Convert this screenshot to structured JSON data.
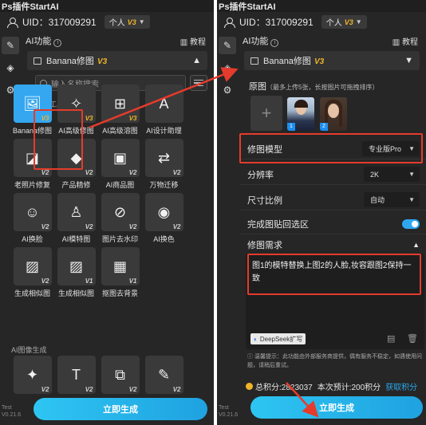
{
  "app": {
    "title": "Ps插件StartAI",
    "version": "Test V0.21.6"
  },
  "account": {
    "uid": "UID：317009291",
    "persona": "个人",
    "persona_badge": "V3"
  },
  "sidebar": {
    "items": [
      {
        "icon": "pen-icon"
      },
      {
        "icon": "layers-icon"
      },
      {
        "icon": "gear-icon"
      }
    ]
  },
  "left": {
    "section_title": "AI功能",
    "tutorial": "教程",
    "selected_model": "Banana修图",
    "selected_badge": "V3",
    "search_placeholder": "输入名称搜索",
    "category_industry": "行业工具",
    "tools": [
      {
        "name": "Banana修图",
        "badge": "V3",
        "icon": "image-edit-icon"
      },
      {
        "name": "AI高级修图",
        "badge": "V3",
        "icon": "magic-wand-icon"
      },
      {
        "name": "AI高级溶图",
        "badge": "V3",
        "icon": "image-plus-icon"
      },
      {
        "name": "AI设计助理",
        "badge": "",
        "icon": "design-assistant-icon"
      },
      {
        "name": "老照片修复",
        "badge": "V2",
        "icon": "repair-icon"
      },
      {
        "name": "产品精修",
        "badge": "V2",
        "icon": "diamond-icon"
      },
      {
        "name": "AI商品图",
        "badge": "V2",
        "icon": "shopping-bag-icon"
      },
      {
        "name": "万物迁移",
        "badge": "V2",
        "icon": "transfer-icon"
      },
      {
        "name": "AI换脸",
        "badge": "V2",
        "icon": "face-icon"
      },
      {
        "name": "AI模特图",
        "badge": "V2",
        "icon": "model-icon"
      },
      {
        "name": "图片去水印",
        "badge": "V2",
        "icon": "no-watermark-icon"
      },
      {
        "name": "AI换色",
        "badge": "V2",
        "icon": "palette-icon"
      },
      {
        "name": "生成相似图",
        "badge": "V2",
        "icon": "similar-image-icon"
      },
      {
        "name": "生成相似图",
        "badge": "V1",
        "icon": "similar-image-icon"
      },
      {
        "name": "抠图去背景",
        "badge": "V1",
        "icon": "cutout-icon"
      }
    ],
    "category_image": "AI图像生成",
    "image_tools": [
      {
        "badge": "V2",
        "icon": "sparkle-icon"
      },
      {
        "badge": "V2",
        "icon": "text-to-image-icon"
      },
      {
        "badge": "V2",
        "icon": "image-to-image-icon"
      },
      {
        "badge": "V2",
        "icon": "sketch-icon"
      }
    ],
    "generate_label": "立即生成"
  },
  "right": {
    "section_title": "AI功能",
    "tutorial": "教程",
    "selected_model": "Banana修图",
    "selected_badge": "V3",
    "source_label": "原图",
    "source_hint": "（最多上传5张，长按图片可拖拽排序）",
    "thumb_numbers": [
      "1",
      "2"
    ],
    "model_label": "修图模型",
    "model_value": "专业版Pro",
    "resolution_label": "分辨率",
    "resolution_value": "2K",
    "ratio_label": "尺寸比例",
    "ratio_value": "自动",
    "paste_label": "完成图贴回选区",
    "paste_enabled": true,
    "request_label": "修图需求",
    "request_text": "图1的模特替换上图2的人脸,妆容跟图2保持一致",
    "deepseek_label": "DeepSeek扩写",
    "notice": "温馨提示：此功能由外部服务商提供，偶有服务不稳定，如遇使用问题，请稍后重试。",
    "points_label": "总积分:2823037",
    "estimate_label": "本次预计:200积分",
    "earn_label": "获取积分",
    "generate_label": "立即生成"
  },
  "colors": {
    "accent": "#2ea7f0",
    "highlight": "#e53b2c",
    "badge_gold": "#f0b429",
    "panel_bg": "#262626"
  }
}
